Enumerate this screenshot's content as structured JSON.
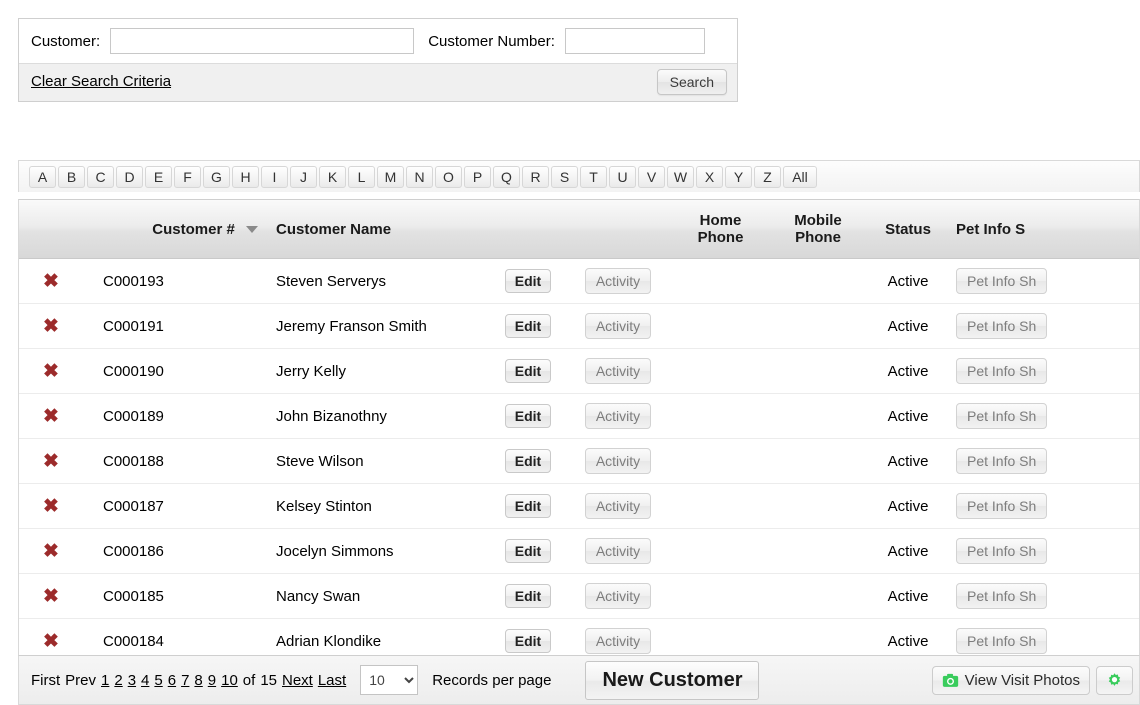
{
  "search": {
    "customer_label": "Customer:",
    "customer_value": "",
    "customer_placeholder": "",
    "number_label": "Customer Number:",
    "number_value": "",
    "number_placeholder": "",
    "clear_link": "Clear Search Criteria",
    "search_button": "Search"
  },
  "alpha_filter": {
    "letters": [
      "A",
      "B",
      "C",
      "D",
      "E",
      "F",
      "G",
      "H",
      "I",
      "J",
      "K",
      "L",
      "M",
      "N",
      "O",
      "P",
      "Q",
      "R",
      "S",
      "T",
      "U",
      "V",
      "W",
      "X",
      "Y",
      "Z"
    ],
    "all_label": "All"
  },
  "grid": {
    "columns": {
      "customer_number": "Customer #",
      "customer_name": "Customer Name",
      "home_phone_line1": "Home",
      "home_phone_line2": "Phone",
      "mobile_phone_line1": "Mobile",
      "mobile_phone_line2": "Phone",
      "status": "Status",
      "pet_info": "Pet Info S"
    },
    "sort_column": "Customer #",
    "sort_direction": "descending",
    "row_actions": {
      "delete_icon": "red-x-icon",
      "edit_label": "Edit",
      "activity_label": "Activity",
      "pet_info_label": "Pet Info Sh"
    },
    "rows": [
      {
        "number": "C000193",
        "name": "Steven Serverys",
        "home_phone": "",
        "mobile_phone": "",
        "status": "Active"
      },
      {
        "number": "C000191",
        "name": "Jeremy Franson Smith",
        "home_phone": "",
        "mobile_phone": "",
        "status": "Active"
      },
      {
        "number": "C000190",
        "name": "Jerry Kelly",
        "home_phone": "",
        "mobile_phone": "",
        "status": "Active"
      },
      {
        "number": "C000189",
        "name": "John Bizanothny",
        "home_phone": "",
        "mobile_phone": "",
        "status": "Active"
      },
      {
        "number": "C000188",
        "name": "Steve Wilson",
        "home_phone": "",
        "mobile_phone": "",
        "status": "Active"
      },
      {
        "number": "C000187",
        "name": "Kelsey Stinton",
        "home_phone": "",
        "mobile_phone": "",
        "status": "Active"
      },
      {
        "number": "C000186",
        "name": "Jocelyn Simmons",
        "home_phone": "",
        "mobile_phone": "",
        "status": "Active"
      },
      {
        "number": "C000185",
        "name": "Nancy Swan",
        "home_phone": "",
        "mobile_phone": "",
        "status": "Active"
      },
      {
        "number": "C000184",
        "name": "Adrian Klondike",
        "home_phone": "",
        "mobile_phone": "",
        "status": "Active"
      }
    ]
  },
  "pager": {
    "first_label": "First",
    "prev_label": "Prev",
    "pages": [
      "1",
      "2",
      "3",
      "4",
      "5",
      "6",
      "7",
      "8",
      "9",
      "10"
    ],
    "of_label": "of",
    "total_pages": "15",
    "next_label": "Next",
    "last_label": "Last",
    "records_per_page_value": "10",
    "records_per_page_options": [
      "10"
    ],
    "records_per_page_label": "Records per page",
    "new_customer_label": "New Customer",
    "view_visit_photos_label": "View Visit Photos",
    "settings_icon": "green-gear-icon",
    "camera_icon": "green-camera-icon"
  },
  "colors": {
    "delete_x": "#9c2b2b",
    "icon_green": "#39cc5c",
    "header_text": "#1a1a1a",
    "muted_button_text": "#7d7d7d"
  }
}
